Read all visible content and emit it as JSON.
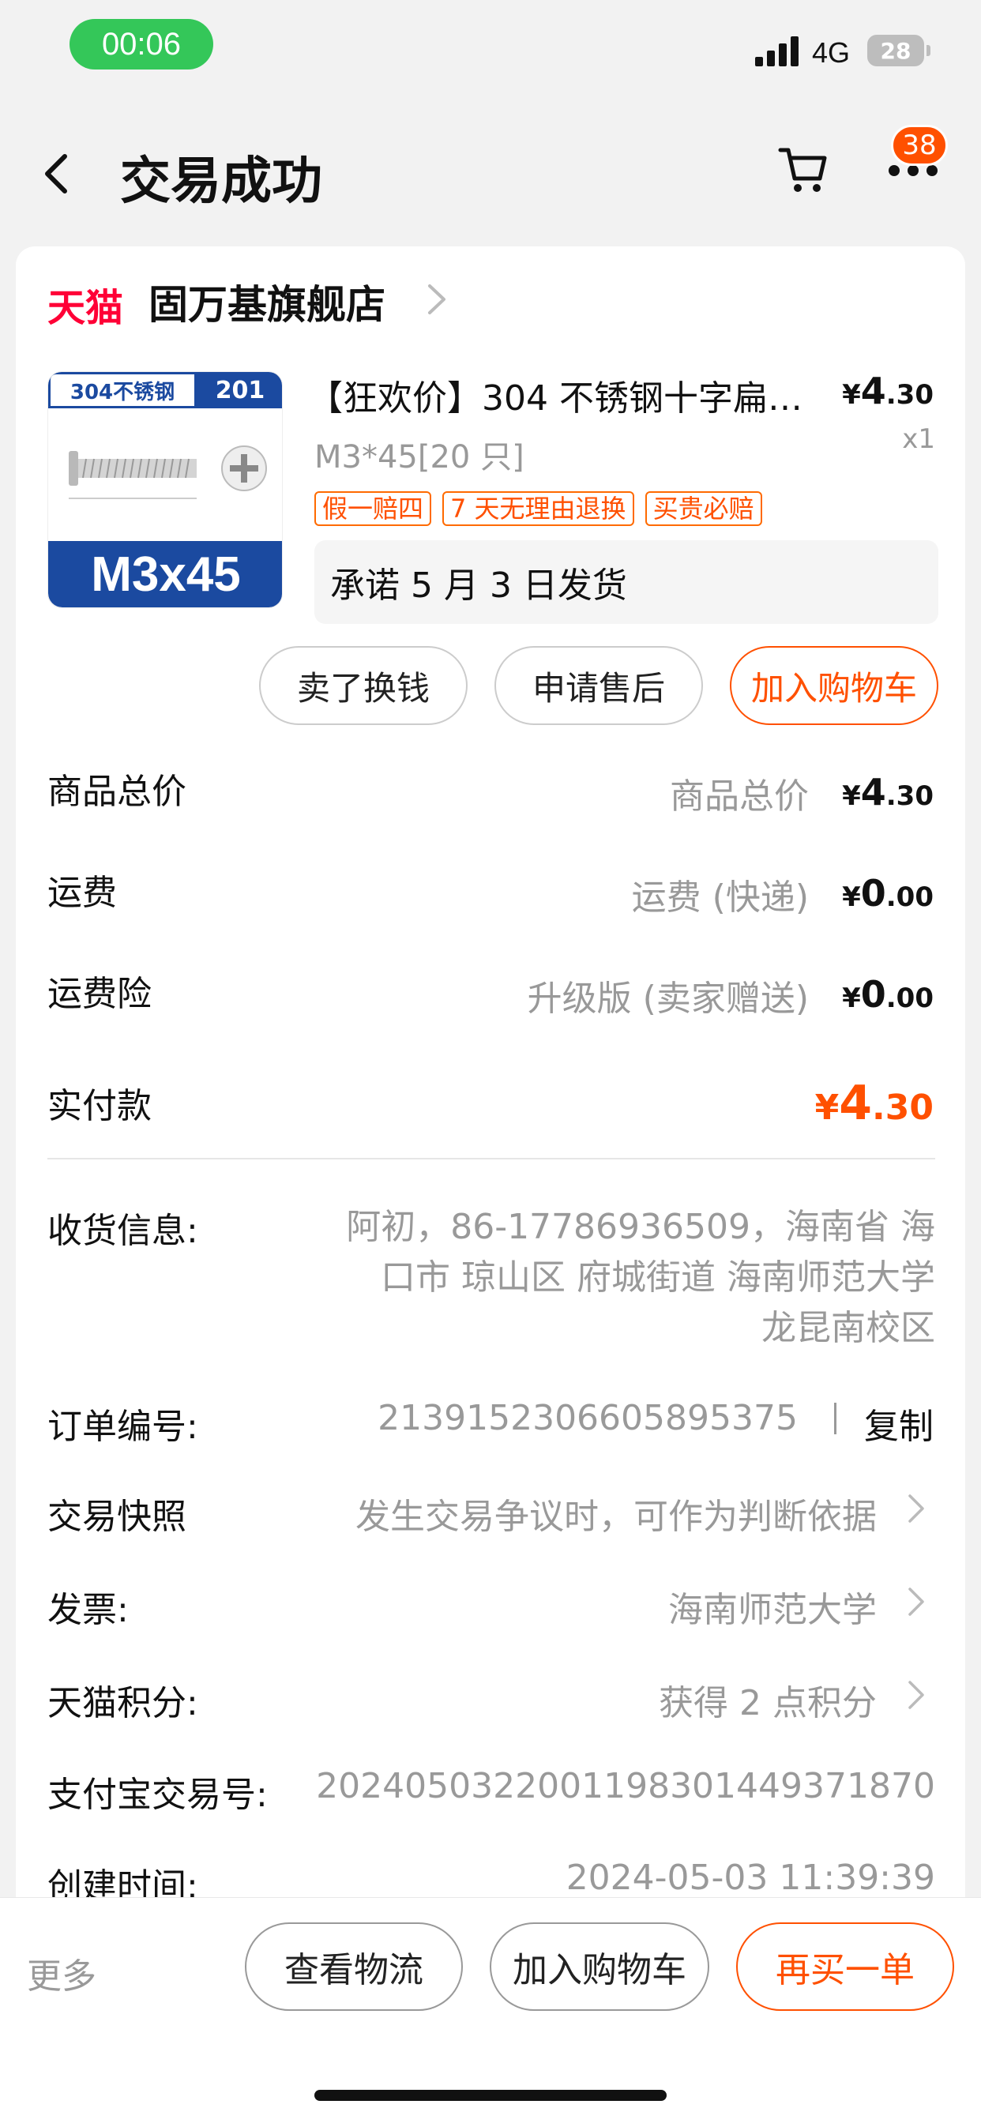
{
  "status_bar": {
    "time": "00:06",
    "network": "4G",
    "battery": "28"
  },
  "header": {
    "title": "交易成功",
    "cart_badge": "38"
  },
  "store": {
    "brand": "天猫",
    "name": "固万基旗舰店"
  },
  "product": {
    "name": "【狂欢价】304 不锈钢十字扁…",
    "thumb_top_left": "304不锈钢",
    "thumb_top_right": "201",
    "thumb_bottom": "M3x45",
    "price_currency": "¥",
    "price_int": "4",
    "price_dec": ".30",
    "qty": "x1",
    "sku": "M3*45[20 只]",
    "tags": [
      "假一赔四",
      "7 天无理由退换",
      "买贵必赔"
    ],
    "promise": "承诺 5 月 3 日发货"
  },
  "actions": {
    "sell": "卖了换钱",
    "after_sale": "申请售后",
    "add_cart": "加入购物车"
  },
  "fees": [
    {
      "label": "商品总价",
      "sub": "商品总价",
      "currency": "¥",
      "int": "4",
      "dec": ".30"
    },
    {
      "label": "运费",
      "sub": "运费 (快递)",
      "currency": "¥",
      "int": "0",
      "dec": ".00"
    },
    {
      "label": "运费险",
      "sub": "升级版 (卖家赠送)",
      "currency": "¥",
      "int": "0",
      "dec": ".00"
    }
  ],
  "paid": {
    "label": "实付款",
    "currency": "¥",
    "int": "4",
    "dec": ".30"
  },
  "info": {
    "address_label": "收货信息:",
    "address_line1": "阿初，86-17786936509，海南省 海",
    "address_line2": "口市 琼山区 府城街道 海南师范大学",
    "address_line3": "龙昆南校区",
    "order_label": "订单编号:",
    "order_no": "2139152306605895375",
    "copy": "复制",
    "snapshot_label": "交易快照",
    "snapshot_value": "发生交易争议时，可作为判断依据",
    "invoice_label": "发票:",
    "invoice_value": "海南师范大学",
    "points_label": "天猫积分:",
    "points_value": "获得 2 点积分",
    "alipay_label": "支付宝交易号:",
    "alipay_value": "2024050322001198301449371870",
    "created_label": "创建时间:",
    "created_value": "2024-05-03 11:39:39"
  },
  "bottom_bar": {
    "more": "更多",
    "logistics": "查看物流",
    "add_cart": "加入购物车",
    "rebuy": "再买一单"
  }
}
